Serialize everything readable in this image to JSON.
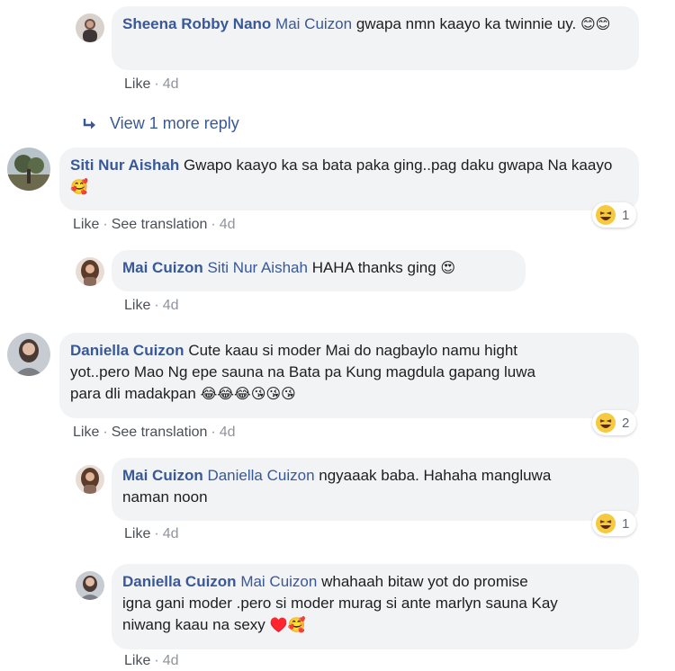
{
  "comments": [
    {
      "author": "Sheena Robby Nano",
      "mention": "Mai Cuizon",
      "text": "gwapa nmn kaayo ka twinnie uy.",
      "emoji": "😊😊",
      "like": "Like",
      "time": "4d"
    },
    {
      "author": "Siti Nur Aishah",
      "text": "Gwapo kaayo ka sa bata paka ging..pag daku gwapa Na kaayo",
      "emoji": "🥰",
      "like": "Like",
      "see_translation": "See translation",
      "time": "4d",
      "reaction_count": "1",
      "reaction_icon": "haha-icon"
    },
    {
      "author": "Mai Cuizon",
      "mention": "Siti Nur Aishah",
      "text": "HAHA thanks ging",
      "emoji": "😍",
      "like": "Like",
      "time": "4d"
    },
    {
      "author": "Daniella Cuizon",
      "text_line1": "Cute kaau si moder Mai do nagbaylo namu hight",
      "text_line2": "yot..pero Mao Ng epe sauna na Bata pa Kung magdula gapang luwa",
      "text_line3": "para dli madakpan",
      "emoji": "😂😂😂😘😘😘",
      "like": "Like",
      "see_translation": "See translation",
      "time": "4d",
      "reaction_count": "2",
      "reaction_icon": "haha-icon"
    },
    {
      "author": "Mai Cuizon",
      "mention": "Daniella Cuizon",
      "text_line1": "ngyaaak baba. Hahaha mangluwa",
      "text_line2": "naman noon",
      "like": "Like",
      "time": "4d",
      "reaction_count": "1",
      "reaction_icon": "haha-icon"
    },
    {
      "author": "Daniella Cuizon",
      "mention": "Mai Cuizon",
      "text_line1": "whahaah bitaw yot do promise",
      "text_line2": "igna gani moder .pero si moder murag si ante marlyn sauna Kay",
      "text_line3": "niwang kaau na sexy",
      "emoji": "♥️🥰",
      "like": "Like",
      "time": "4d"
    }
  ],
  "view_more": {
    "label": "View 1 more reply",
    "icon": "reply-arrow-icon"
  },
  "colors": {
    "link": "#385898",
    "bubble": "#f2f3f5",
    "meta": "#606770"
  }
}
